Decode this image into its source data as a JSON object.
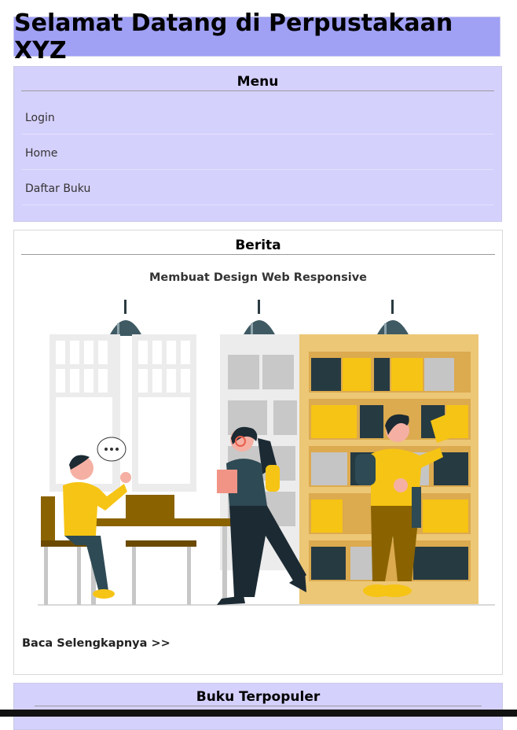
{
  "header": {
    "title": "Selamat Datang di Perpustakaan XYZ"
  },
  "menu": {
    "title": "Menu",
    "items": [
      {
        "label": "Login"
      },
      {
        "label": "Home"
      },
      {
        "label": "Daftar Buku"
      }
    ]
  },
  "news": {
    "title": "Berita",
    "article_title": "Membuat Design Web Responsive",
    "read_more": "Baca Selengkapnya >>"
  },
  "popular": {
    "title": "Buku Terpopuler"
  },
  "colors": {
    "header_bg": "#a0a0f5",
    "menu_bg": "#d5d1fd",
    "accent_yellow": "#f6c414"
  }
}
